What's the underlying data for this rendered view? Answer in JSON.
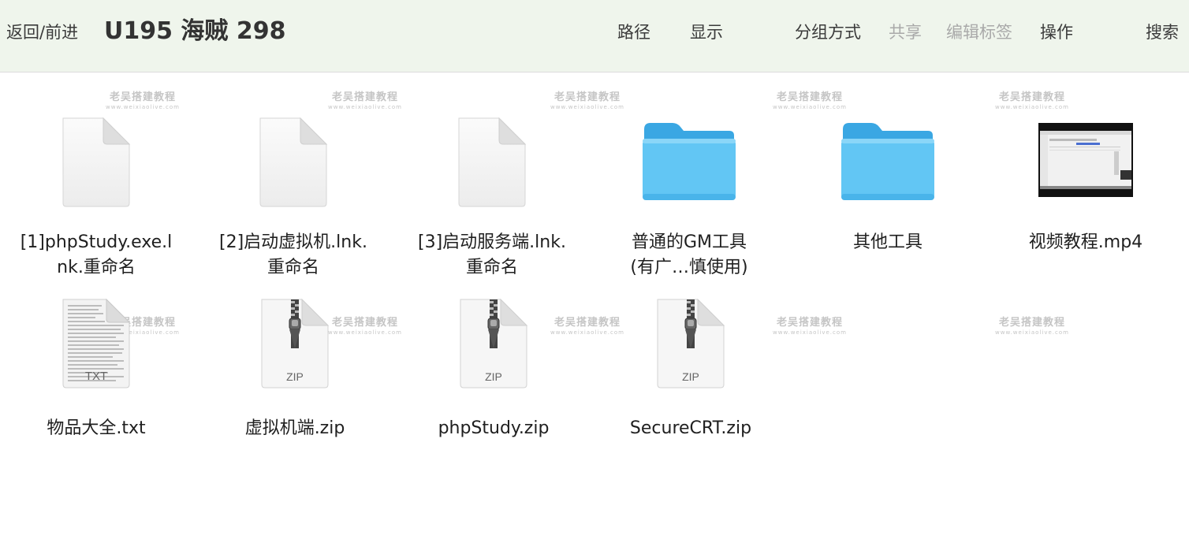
{
  "toolbar": {
    "back_forward": "返回/前进",
    "title": "U195 海贼 298",
    "path": "路径",
    "display": "显示",
    "group_by": "分组方式",
    "share": "共享",
    "edit_tags": "编辑标签",
    "actions": "操作",
    "search": "搜索"
  },
  "watermark": {
    "cn": "老吴搭建教程",
    "en": "www.weixiaolive.com"
  },
  "items": [
    {
      "kind": "doc",
      "line1": "[1]phpStudy.exe.l",
      "line2": "nk.重命名"
    },
    {
      "kind": "doc",
      "line1": "[2]启动虚拟机.lnk.",
      "line2": "重命名"
    },
    {
      "kind": "doc",
      "line1": "[3]启动服务端.lnk.",
      "line2": "重命名"
    },
    {
      "kind": "folder",
      "line1": "普通的GM工具",
      "line2": "(有广…慎使用)"
    },
    {
      "kind": "folder",
      "line1": "其他工具",
      "line2": ""
    },
    {
      "kind": "video",
      "line1": "视频教程.mp4",
      "line2": ""
    },
    {
      "kind": "txt",
      "line1": "物品大全.txt",
      "line2": "",
      "badge": "TXT"
    },
    {
      "kind": "zip",
      "line1": "虚拟机端.zip",
      "line2": "",
      "badge": "ZIP"
    },
    {
      "kind": "zip",
      "line1": "phpStudy.zip",
      "line2": "",
      "badge": "ZIP"
    },
    {
      "kind": "zip",
      "line1": "SecureCRT.zip",
      "line2": "",
      "badge": "ZIP"
    }
  ],
  "colors": {
    "folder": "#5ac8f5",
    "toolbar_bg": "#eff5ec"
  }
}
